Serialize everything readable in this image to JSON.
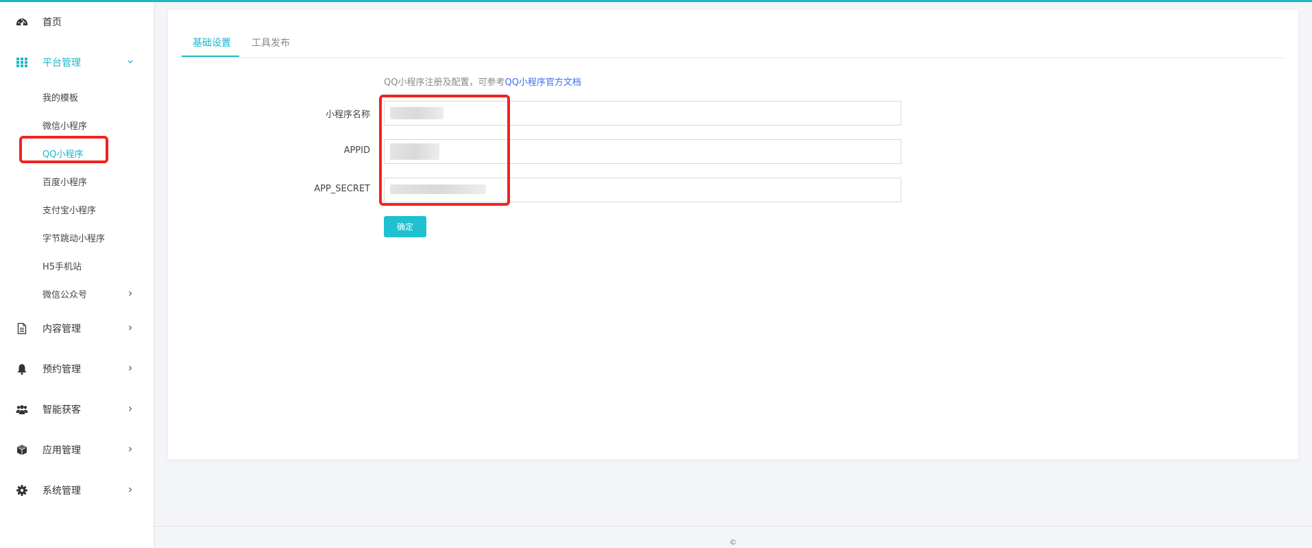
{
  "sidebar": {
    "home": "首页",
    "platform": "平台管理",
    "sub_items": [
      "我的模板",
      "微信小程序",
      "QQ小程序",
      "百度小程序",
      "支付宝小程序",
      "字节跳动小程序",
      "H5手机站",
      "微信公众号"
    ],
    "content": "内容管理",
    "booking": "预约管理",
    "leads": "智能获客",
    "apps": "应用管理",
    "system": "系统管理"
  },
  "tabs": [
    "基础设置",
    "工具发布"
  ],
  "form": {
    "hint_prefix": "QQ小程序注册及配置，可参考",
    "hint_link": "QQ小程序官方文档",
    "name_label": "小程序名称",
    "appid_label": "APPID",
    "secret_label": "APP_SECRET",
    "submit": "确定"
  },
  "footer": "©",
  "colors": {
    "accent": "#1fb5c9",
    "highlight": "#f2221f",
    "link": "#3a6ff2"
  }
}
